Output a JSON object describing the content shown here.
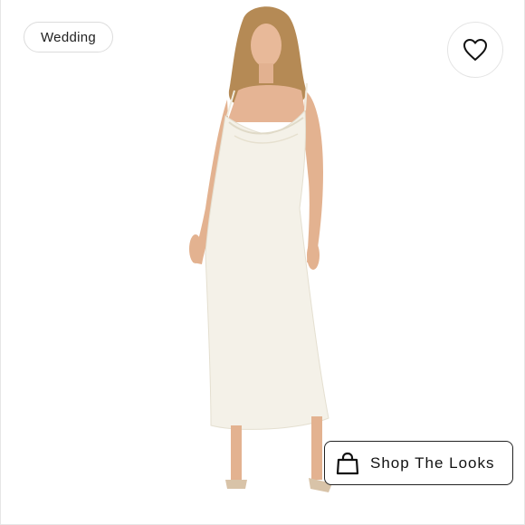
{
  "listing": {
    "tag_label": "Wedding",
    "shop_label": "Shop The Looks"
  },
  "icons": {
    "like": "heart-icon",
    "bag": "shopping-bag-icon"
  },
  "colors": {
    "dress": "#f4f1e8",
    "border": "#222222",
    "chip_border": "#dcdcdc"
  }
}
